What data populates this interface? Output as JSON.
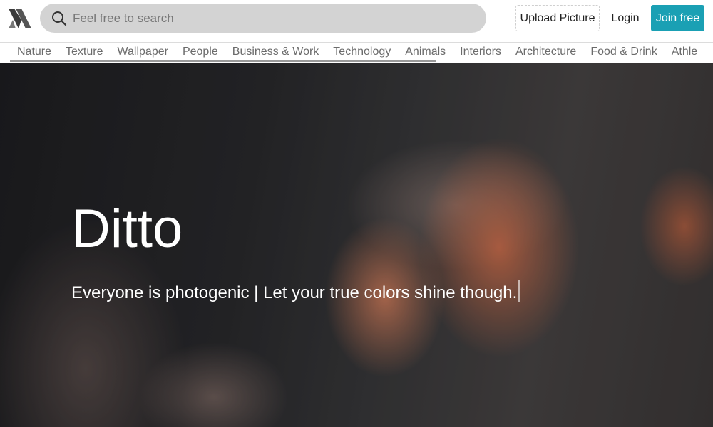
{
  "header": {
    "logo_icon": "ditto-logo-icon",
    "search": {
      "icon": "search-icon",
      "placeholder": "Feel free to search",
      "value": ""
    },
    "upload_label": "Upload Picture",
    "login_label": "Login",
    "join_label": "Join free",
    "colors": {
      "accent": "#1aa0b4",
      "search_bg": "#d3d3d3"
    }
  },
  "categories": [
    "Nature",
    "Texture",
    "Wallpaper",
    "People",
    "Business & Work",
    "Technology",
    "Animals",
    "Interiors",
    "Architecture",
    "Food & Drink",
    "Athle"
  ],
  "hero": {
    "title": "Ditto",
    "subtitle": "Everyone is photogenic | Let your true colors shine though."
  }
}
